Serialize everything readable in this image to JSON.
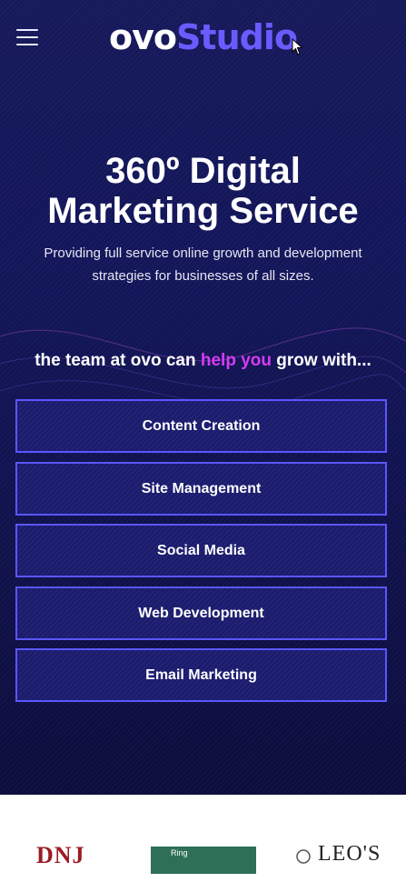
{
  "header": {
    "logo_part1": "ovo",
    "logo_part2": "Studio"
  },
  "hero": {
    "headline_line1": "360º Digital",
    "headline_line2": "Marketing Service",
    "subtitle_line1": "Providing full service online growth and development",
    "subtitle_line2": "strategies for businesses of all sizes.",
    "tagline_before": "the team at ovo can ",
    "tagline_highlight": "help you",
    "tagline_after": " grow with..."
  },
  "services": [
    {
      "label": "Content Creation"
    },
    {
      "label": "Site Management"
    },
    {
      "label": "Social Media"
    },
    {
      "label": "Web Development"
    },
    {
      "label": "Email Marketing"
    }
  ],
  "client_logos": {
    "dnj": "DNJ",
    "ring": "Ring",
    "leos": "LEO'S"
  },
  "colors": {
    "background": "#13165a",
    "accent": "#6a5bff",
    "highlight": "#d63cf2",
    "button_border": "#5b56ff",
    "button_fill": "#1b1c6e"
  },
  "icons": {
    "menu": "hamburger-menu-icon",
    "cursor": "mouse-pointer-icon"
  }
}
